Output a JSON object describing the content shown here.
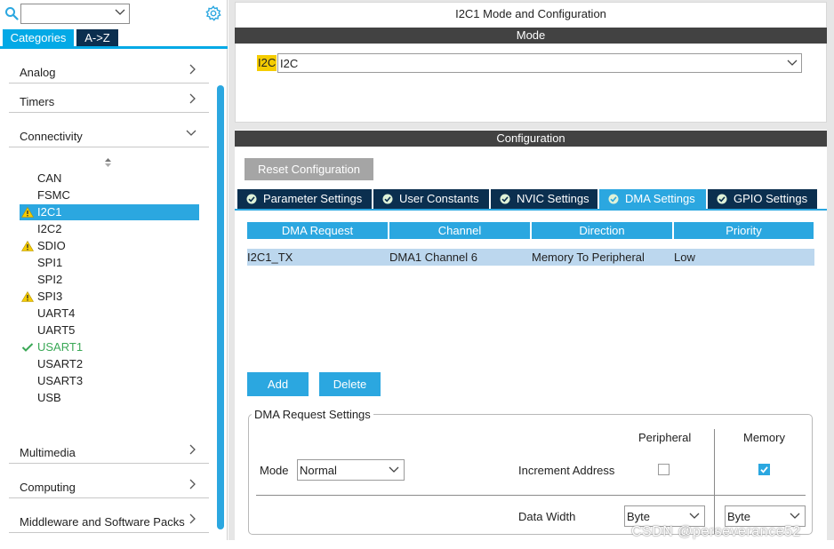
{
  "left": {
    "tabs": {
      "categories": "Categories",
      "az": "A->Z"
    },
    "categories": [
      {
        "label": "Analog",
        "state": "collapsed"
      },
      {
        "label": "Timers",
        "state": "collapsed"
      },
      {
        "label": "Connectivity",
        "state": "expanded"
      },
      {
        "label": "Multimedia",
        "state": "collapsed"
      },
      {
        "label": "Computing",
        "state": "collapsed"
      },
      {
        "label": "Middleware and Software Packs",
        "state": "collapsed"
      }
    ],
    "connectivity_items": [
      {
        "label": "CAN",
        "status": "none"
      },
      {
        "label": "FSMC",
        "status": "none"
      },
      {
        "label": "I2C1",
        "status": "warning",
        "selected": true
      },
      {
        "label": "I2C2",
        "status": "none"
      },
      {
        "label": "SDIO",
        "status": "warning"
      },
      {
        "label": "SPI1",
        "status": "none"
      },
      {
        "label": "SPI2",
        "status": "none"
      },
      {
        "label": "SPI3",
        "status": "warning"
      },
      {
        "label": "UART4",
        "status": "none"
      },
      {
        "label": "UART5",
        "status": "none"
      },
      {
        "label": "USART1",
        "status": "ok"
      },
      {
        "label": "USART2",
        "status": "none"
      },
      {
        "label": "USART3",
        "status": "none"
      },
      {
        "label": "USB",
        "status": "none"
      }
    ]
  },
  "right": {
    "title": "I2C1 Mode and Configuration",
    "mode_header": "Mode",
    "mode_tag": "I2C",
    "mode_value": "I2C",
    "config_header": "Configuration",
    "reset_button": "Reset Configuration",
    "config_tabs": [
      {
        "label": "Parameter Settings",
        "active": false
      },
      {
        "label": "User Constants",
        "active": false
      },
      {
        "label": "NVIC Settings",
        "active": false
      },
      {
        "label": "DMA Settings",
        "active": true
      },
      {
        "label": "GPIO Settings",
        "active": false
      }
    ],
    "dma_table": {
      "headers": [
        "DMA Request",
        "Channel",
        "Direction",
        "Priority"
      ],
      "rows": [
        [
          "I2C1_TX",
          "DMA1 Channel 6",
          "Memory To Peripheral",
          "Low"
        ]
      ]
    },
    "add_button": "Add",
    "delete_button": "Delete",
    "request_settings": {
      "legend": "DMA Request Settings",
      "peripheral_header": "Peripheral",
      "memory_header": "Memory",
      "mode_label": "Mode",
      "mode_value": "Normal",
      "increment_label": "Increment Address",
      "increment_peripheral": false,
      "increment_memory": true,
      "data_width_label": "Data Width",
      "peripheral_width": "Byte",
      "memory_width": "Byte"
    }
  },
  "watermark": "CSDN @perseverance52",
  "colors": {
    "accent": "#2ba7e0",
    "dark_tab": "#0b2f4f",
    "header_bar": "#424242",
    "warning": "#f5cc00",
    "ok": "#3aa856"
  }
}
